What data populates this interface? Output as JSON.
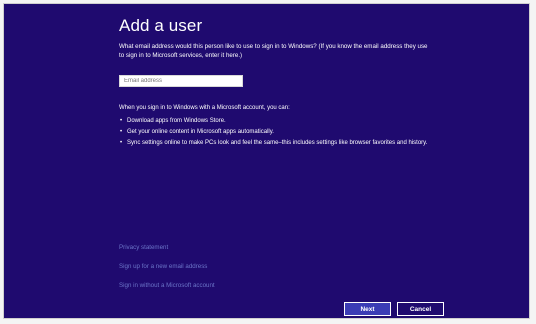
{
  "page": {
    "title": "Add a user",
    "intro": "What email address would this person like to use to sign in to Windows? (If you know the email address they use to sign in to Microsoft services, enter it here.)"
  },
  "email_input": {
    "placeholder": "Email address",
    "value": ""
  },
  "benefits": {
    "heading": "When you sign in to Windows with a Microsoft account, you can:",
    "bullet": "•",
    "items": [
      "Download apps from Windows Store.",
      "Get your online content in Microsoft apps automatically.",
      "Sync settings online to make PCs look and feel the same–this includes settings like browser favorites and history."
    ]
  },
  "links": {
    "privacy": "Privacy statement",
    "signup": "Sign up for a new email address",
    "no_microsoft_account": "Sign in without a Microsoft account"
  },
  "buttons": {
    "next": "Next",
    "cancel": "Cancel"
  },
  "colors": {
    "background": "#1f0a6f",
    "link": "#6b75c8",
    "primary_button": "#3b3cb5",
    "text": "#ffffff"
  }
}
